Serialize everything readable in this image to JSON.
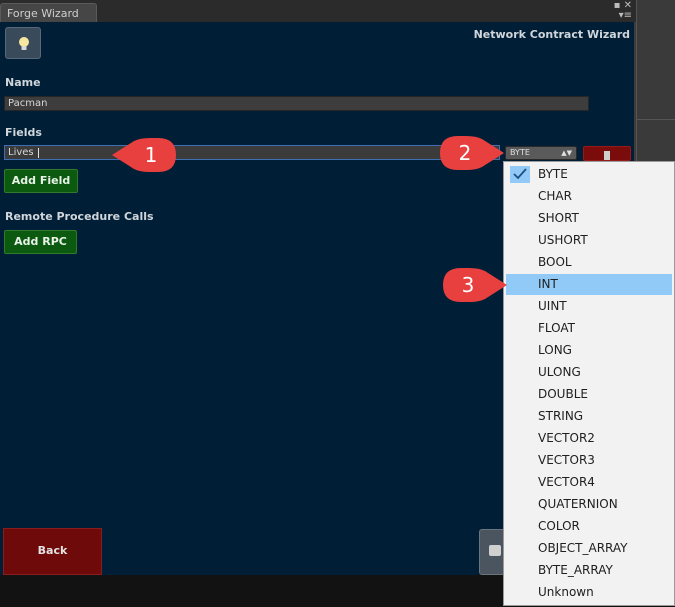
{
  "window": {
    "tab_title": "Forge Wizard",
    "controls_glyph": "▪ ✕ ▾≡"
  },
  "header": {
    "title": "Network Contract Wizard"
  },
  "name": {
    "label": "Name",
    "value": "Pacman"
  },
  "fields": {
    "label": "Fields",
    "field_name_value": "Lives",
    "type_selected": "BYTE",
    "add_button": "Add Field"
  },
  "rpc": {
    "label": "Remote Procedure Calls",
    "add_button": "Add RPC"
  },
  "footer": {
    "back_button": "Back"
  },
  "type_menu": {
    "items": [
      "BYTE",
      "CHAR",
      "SHORT",
      "USHORT",
      "BOOL",
      "INT",
      "UINT",
      "FLOAT",
      "LONG",
      "ULONG",
      "DOUBLE",
      "STRING",
      "VECTOR2",
      "VECTOR3",
      "VECTOR4",
      "QUATERNION",
      "COLOR",
      "OBJECT_ARRAY",
      "BYTE_ARRAY",
      "Unknown"
    ],
    "checked_index": 0,
    "highlighted_index": 5
  },
  "callouts": [
    "1",
    "2",
    "3"
  ],
  "colors": {
    "panel_bg": "#001e35",
    "callout_red": "#e8403f",
    "green_button": "#0b5a10",
    "back_button": "#6e0a0a",
    "menu_highlight": "#91c9f7"
  },
  "icons": [
    "lightbulb-icon",
    "trash-icon",
    "save-icon",
    "checkmark-icon"
  ]
}
